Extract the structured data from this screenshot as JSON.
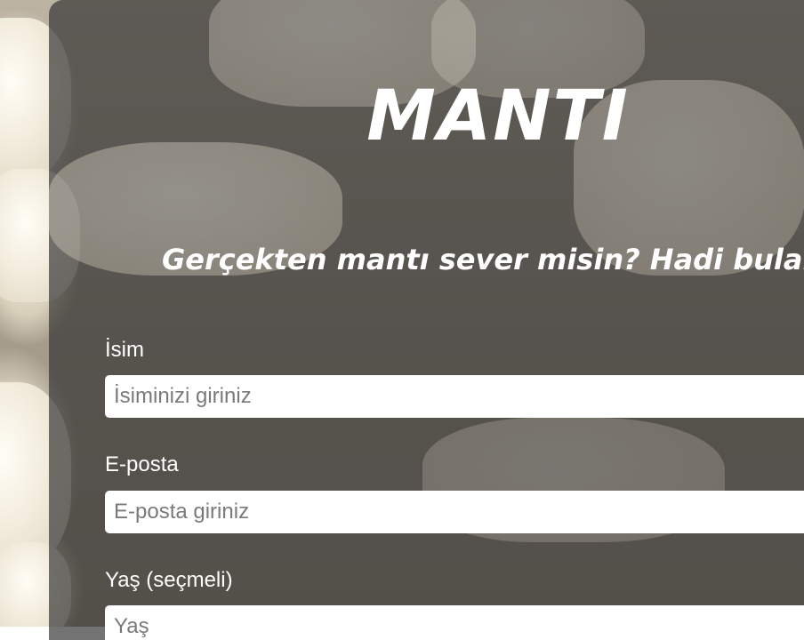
{
  "header": {
    "title": "MANTI",
    "subtitle": "Gerçekten mantı sever misin? Hadi bulalım"
  },
  "form": {
    "name": {
      "label": "İsim",
      "placeholder": "İsiminizi giriniz"
    },
    "email": {
      "label": "E-posta",
      "placeholder": "E-posta giriniz"
    },
    "age": {
      "label": "Yaş (seçmeli)",
      "placeholder": "Yaş"
    }
  }
}
